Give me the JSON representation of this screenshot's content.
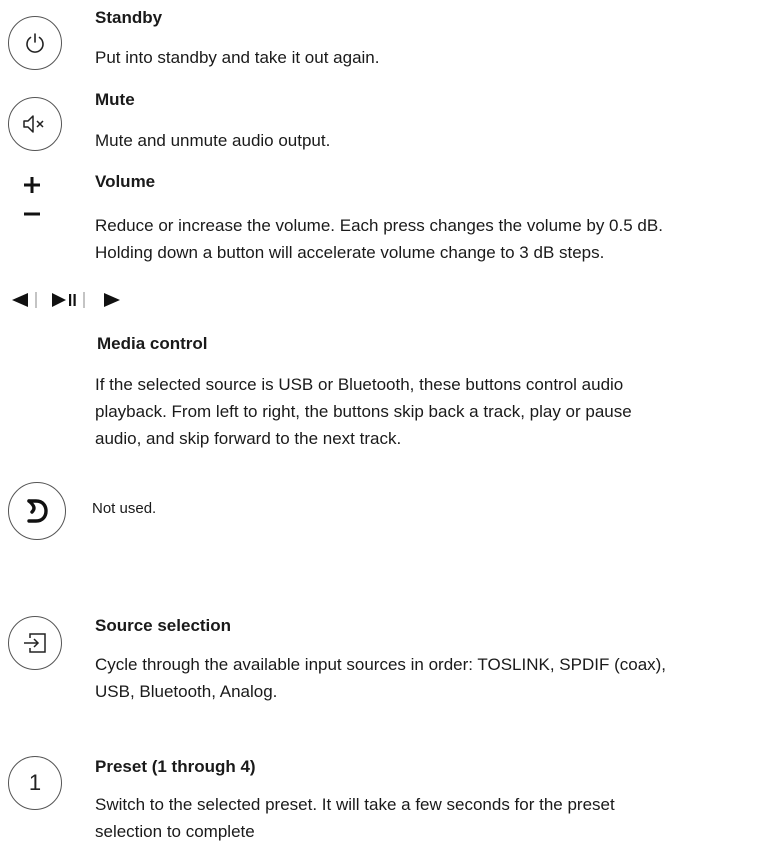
{
  "sections": {
    "standby": {
      "icon": "power-icon",
      "title": "Standby",
      "description": "Put  into standby and take it out again."
    },
    "mute": {
      "icon": "speaker-mute-icon",
      "title": "Mute",
      "description": "Mute and unmute audio output."
    },
    "volume": {
      "icons": [
        "plus-icon",
        "minus-icon"
      ],
      "title": "Volume",
      "lines": [
        "Reduce or increase the volume. Each press changes the volume by 0.5 dB.",
        "Holding down a button will accelerate volume change to 3 dB steps."
      ]
    },
    "media": {
      "icons": [
        "skip-back-icon",
        "play-pause-icon",
        "skip-forward-icon"
      ],
      "title": "Media control",
      "lines": [
        "If the selected source is USB or Bluetooth, these buttons control audio",
        "playback. From left to right, the buttons skip back a track, play or pause",
        "audio, and skip forward to the next track."
      ]
    },
    "unused": {
      "icon": "dirac-logo-icon",
      "description": "Not used."
    },
    "source": {
      "icon": "input-source-icon",
      "title": "Source selection",
      "lines": [
        "Cycle through the available input sources in order: TOSLINK, SPDIF (coax),",
        "USB, Bluetooth, Analog."
      ]
    },
    "preset": {
      "icon_digit": "1",
      "title": "Preset (1 through 4)",
      "lines": [
        "Switch to the selected preset. It will take a few seconds for the preset",
        "selection to complete"
      ]
    }
  }
}
